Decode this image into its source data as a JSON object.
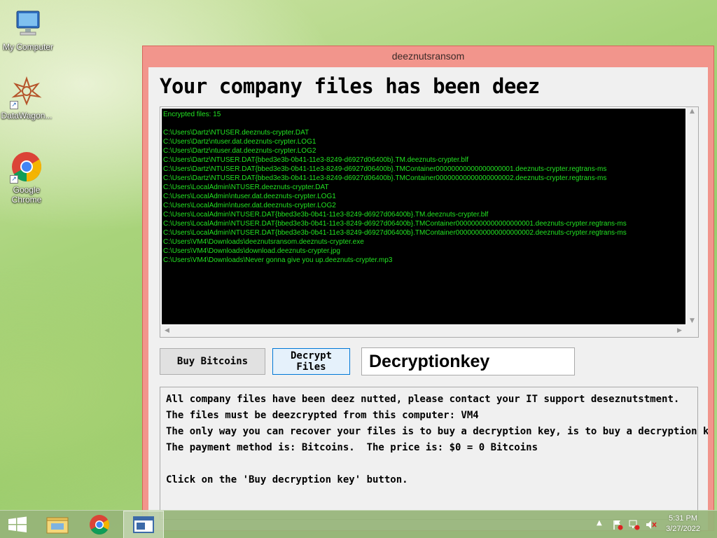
{
  "desktop": {
    "icons": [
      {
        "label": "My Computer"
      },
      {
        "label": "DataWagon..."
      },
      {
        "label": "Google Chrome"
      }
    ]
  },
  "window": {
    "title": "deeznutsransom",
    "heading": "Your company files has been deez",
    "console_lines": [
      "Encrypted files: 15",
      "",
      "C:\\Users\\Dartz\\NTUSER.deeznuts-crypter.DAT",
      "C:\\Users\\Dartz\\ntuser.dat.deeznuts-crypter.LOG1",
      "C:\\Users\\Dartz\\ntuser.dat.deeznuts-crypter.LOG2",
      "C:\\Users\\Dartz\\NTUSER.DAT{bbed3e3b-0b41-11e3-8249-d6927d06400b}.TM.deeznuts-crypter.blf",
      "C:\\Users\\Dartz\\NTUSER.DAT{bbed3e3b-0b41-11e3-8249-d6927d06400b}.TMContainer00000000000000000001.deeznuts-crypter.regtrans-ms",
      "C:\\Users\\Dartz\\NTUSER.DAT{bbed3e3b-0b41-11e3-8249-d6927d06400b}.TMContainer00000000000000000002.deeznuts-crypter.regtrans-ms",
      "C:\\Users\\LocalAdmin\\NTUSER.deeznuts-crypter.DAT",
      "C:\\Users\\LocalAdmin\\ntuser.dat.deeznuts-crypter.LOG1",
      "C:\\Users\\LocalAdmin\\ntuser.dat.deeznuts-crypter.LOG2",
      "C:\\Users\\LocalAdmin\\NTUSER.DAT{bbed3e3b-0b41-11e3-8249-d6927d06400b}.TM.deeznuts-crypter.blf",
      "C:\\Users\\LocalAdmin\\NTUSER.DAT{bbed3e3b-0b41-11e3-8249-d6927d06400b}.TMContainer00000000000000000001.deeznuts-crypter.regtrans-ms",
      "C:\\Users\\LocalAdmin\\NTUSER.DAT{bbed3e3b-0b41-11e3-8249-d6927d06400b}.TMContainer00000000000000000002.deeznuts-crypter.regtrans-ms",
      "C:\\Users\\VM4\\Downloads\\deeznutsransom.deeznuts-crypter.exe",
      "C:\\Users\\VM4\\Downloads\\download.deeznuts-crypter.jpg",
      "C:\\Users\\VM4\\Downloads\\Never gonna give you up.deeznuts-crypter.mp3"
    ],
    "buy_button": "Buy Bitcoins",
    "decrypt_button": "Decrypt Files",
    "key_field_value": "Decryptionkey",
    "message_lines": [
      "All company files have been deez nutted, please contact your IT support deseznutstment.",
      "The files must be deezcrypted from this computer: VM4",
      "The only way you can recover your files is to buy a decryption key, is to buy a decryption key.",
      "The payment method is: Bitcoins.  The price is: $0 = 0 Bitcoins",
      "",
      "Click on the 'Buy decryption key' button."
    ]
  },
  "taskbar": {
    "time": "5:31 PM",
    "date": "3/27/2022",
    "apps": [
      "start-icon",
      "file-explorer-icon",
      "chrome-icon",
      "deeznutsransom-app-icon"
    ]
  },
  "colors": {
    "console_text": "#22e322",
    "window_frame": "#f2958c"
  }
}
